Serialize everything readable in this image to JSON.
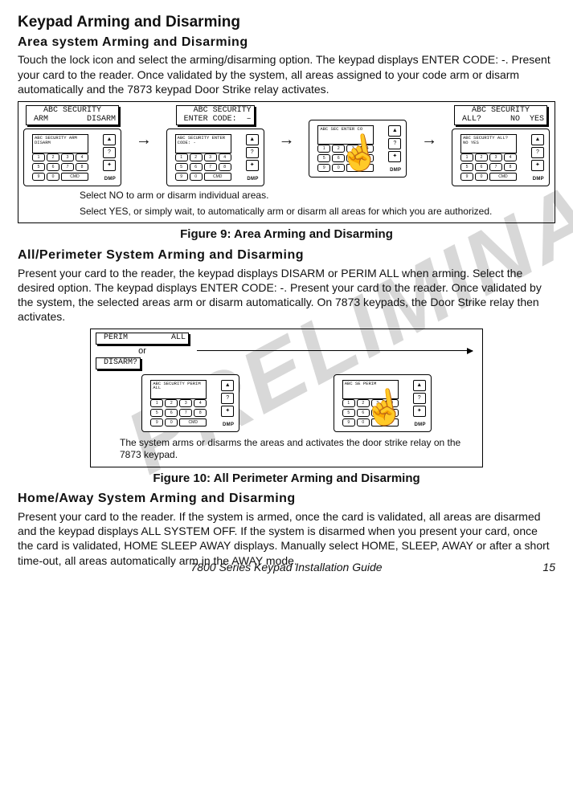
{
  "title": "Keypad Arming and Disarming",
  "section1": {
    "heading": "Area system Arming and Disarming",
    "body": "Touch the lock icon and select the arming/disarming option.  The keypad displays ENTER CODE: -.  Present your card to the reader.  Once validated by the system, all areas assigned to your code arm or disarm automatically and the 7873 keypad Door Strike relay activates."
  },
  "figure9": {
    "caption": "Figure 9: Area Arming and Disarming",
    "lcd1": "   ABC SECURITY\n ARM        DISARM",
    "lcd2": "   ABC SECURITY\n ENTER CODE:  –",
    "lcd3": "   ABC SECURITY\n ALL?      NO  YES",
    "note1": "Select NO to arm or disarm individual areas.",
    "note2": "Select YES, or simply wait, to automatically arm or disarm all areas for which you are authorized.",
    "kp_screen1": "ABC SECURITY\nARM   DISARM",
    "kp_screen2": "ABC SECURITY\nENTER CODE: -",
    "kp_screen3": "ABC SEC\nENTER CO",
    "kp_screen4": "ABC SECURITY\nALL?   NO  YES"
  },
  "section2": {
    "heading": "All/Perimeter System Arming and Disarming",
    "body": "Present your card to the reader, the keypad displays DISARM or PERIM  ALL when arming.  Select the desired option.  The keypad displays ENTER CODE: -. Present your card to the reader.  Once validated by the system, the selected areas arm or disarm automatically.  On 7873 keypads, the Door Strike relay then activates."
  },
  "figure10": {
    "caption": "Figure 10: All Perimeter Arming and Disarming",
    "lcd1": " PERIM         ALL",
    "or": "or",
    "lcd2": " DISARM?",
    "note": "The system arms or disarms the areas and activates the door strike relay on the 7873 keypad.",
    "kp_screen1": "ABC SECURITY\nPERIM    ALL",
    "kp_screen2": "ABC SE\nPERIM"
  },
  "section3": {
    "heading": "Home/Away System Arming and Disarming",
    "body": "Present your card to the reader. If the system is armed, once the card is validated, all areas are disarmed and the keypad displays ALL SYSTEM OFF.  If the system is disarmed when you present your card, once the card is validated, HOME  SLEEP  AWAY displays. Manually select HOME, SLEEP, AWAY or after a short time-out, all areas automatically arm in the AWAY mode."
  },
  "keypad": {
    "keys": [
      "1",
      "2",
      "3",
      "4",
      "5",
      "6",
      "7",
      "8",
      "9",
      "0"
    ],
    "cmd": "CMD",
    "brand": "DMP",
    "side": [
      "▲",
      "?",
      "✦"
    ]
  },
  "footer": {
    "guide": "7800 Series Keypad Installation Guide",
    "page": "15"
  }
}
